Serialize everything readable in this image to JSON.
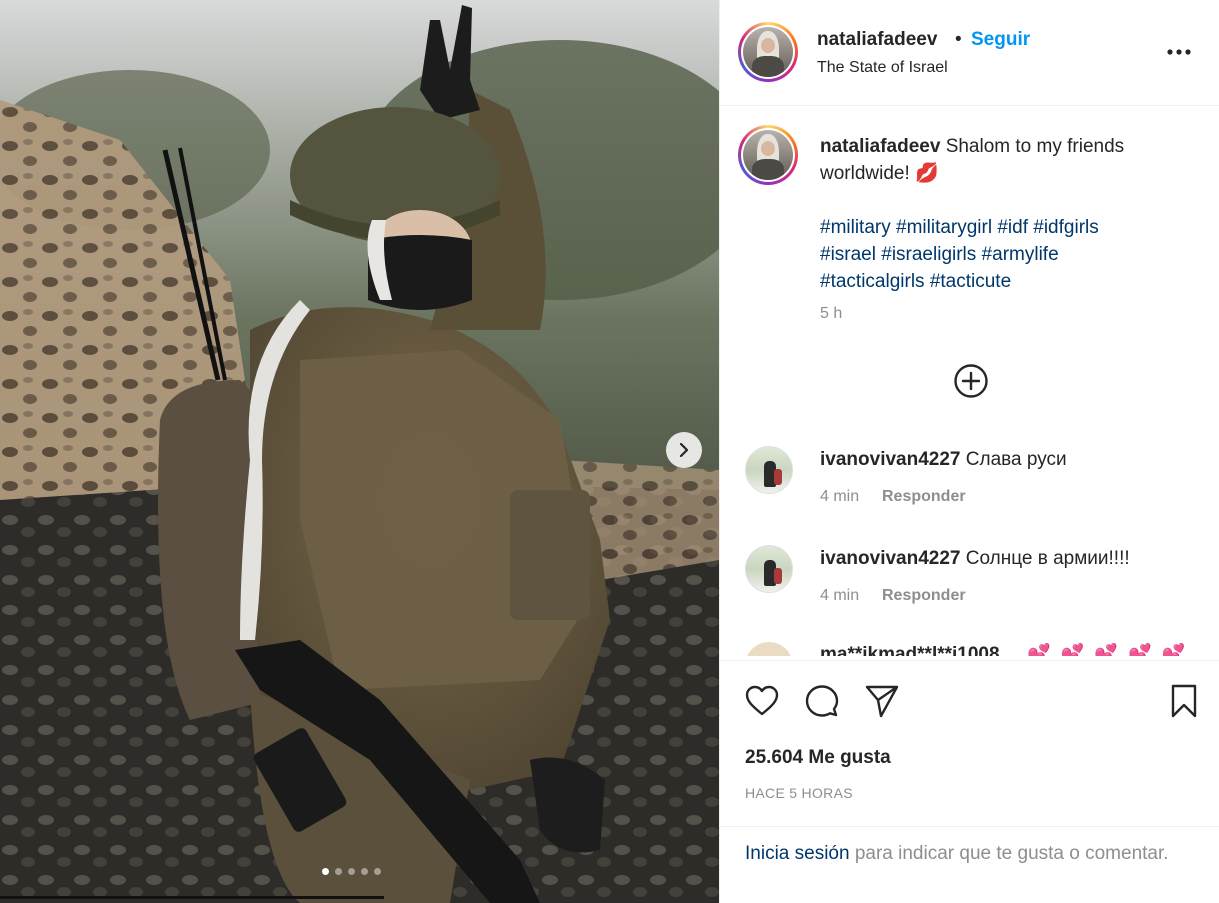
{
  "post": {
    "author": "nataliafadeev",
    "follow_label": "Seguir",
    "separator": "•",
    "location": "The State of Israel",
    "more_icon": "more-horizontal-icon",
    "carousel": {
      "slides": 5,
      "active": 1,
      "next_icon": "chevron-right-icon"
    }
  },
  "caption": {
    "author": "nataliafadeev",
    "text": "Shalom to my friends worldwide! 💋",
    "hashtags_line1": "#military #militarygirl #idf #idfgirls",
    "hashtags_line2": "#israel #israeligirls #armylife",
    "hashtags_line3": "#tacticalgirls #tacticute",
    "time": "5 h"
  },
  "load_more_icon": "plus-circle-icon",
  "comments": [
    {
      "user": "ivanovivan4227",
      "text": "Слава руси",
      "time": "4 min",
      "reply": "Responder"
    },
    {
      "user": "ivanovivan4227",
      "text": "Солнце в армии!!!!",
      "time": "4 min",
      "reply": "Responder"
    }
  ],
  "partial_comment": {
    "user": "ma**ikmad**l**i1008",
    "hearts": "💕💕💕💕💕"
  },
  "actions": {
    "like_icon": "heart-icon",
    "comment_icon": "comment-icon",
    "share_icon": "send-icon",
    "save_icon": "bookmark-icon",
    "likes": "25.604 Me gusta",
    "posted": "HACE 5 HORAS"
  },
  "login": {
    "link": "Inicia sesión",
    "rest": " para indicar que te gusta o comentar."
  },
  "colors": {
    "link_blue": "#0095f6",
    "hashtag_blue": "#00376b",
    "muted": "#8e8e8e"
  }
}
